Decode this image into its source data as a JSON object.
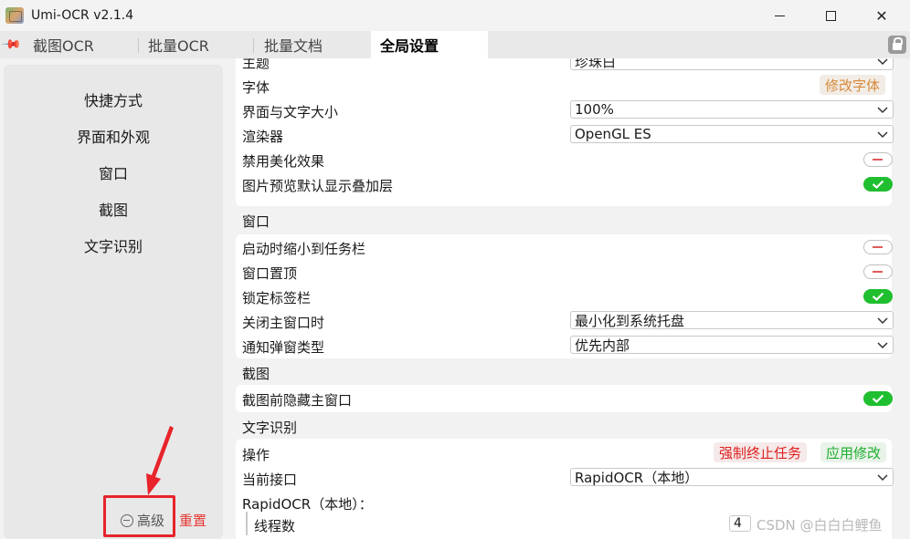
{
  "window": {
    "title": "Umi-OCR v2.1.4",
    "min_icon": "minimize-icon",
    "max_icon": "maximize-icon",
    "close_icon": "close-icon",
    "close_glyph": "✕"
  },
  "tabs": [
    {
      "label": "截图OCR",
      "active": false
    },
    {
      "label": "批量OCR",
      "active": false
    },
    {
      "label": "批量文档",
      "active": false
    },
    {
      "label": "全局设置",
      "active": true
    }
  ],
  "sidebar": {
    "items": [
      "快捷方式",
      "界面和外观",
      "窗口",
      "截图",
      "文字识别"
    ],
    "advanced_label": "高级",
    "reset_label": "重置"
  },
  "settings": {
    "theme_label": "主题",
    "theme_value": "珍珠白",
    "font_label": "字体",
    "font_button": "修改字体",
    "ui_scale_label": "界面与文字大小",
    "ui_scale_value": "100%",
    "renderer_label": "渲染器",
    "renderer_value": "OpenGL ES",
    "disable_effects_label": "禁用美化效果",
    "disable_effects_on": false,
    "preview_overlay_label": "图片预览默认显示叠加层",
    "preview_overlay_on": true,
    "window_section": "窗口",
    "start_minimized_label": "启动时缩小到任务栏",
    "start_minimized_on": false,
    "always_on_top_label": "窗口置顶",
    "always_on_top_on": false,
    "lock_tabs_label": "锁定标签栏",
    "lock_tabs_on": true,
    "close_main_label": "关闭主窗口时",
    "close_main_value": "最小化到系统托盘",
    "notify_type_label": "通知弹窗类型",
    "notify_type_value": "优先内部",
    "screenshot_section": "截图",
    "hide_before_capture_label": "截图前隐藏主窗口",
    "hide_before_capture_on": true,
    "ocr_section": "文字识别",
    "operation_label": "操作",
    "force_stop_button": "强制终止任务",
    "apply_button": "应用修改",
    "current_api_label": "当前接口",
    "current_api_value": "RapidOCR（本地）",
    "rapid_group_label": "RapidOCR（本地）：",
    "threads_label": "线程数",
    "threads_value": "4"
  },
  "watermark": "CSDN @白白白鲤鱼",
  "colors": {
    "toggle_on": "#1fbf2f",
    "stop_red": "#e02020",
    "apply_green": "#1fae2f",
    "annotation_red": "#e8232a"
  }
}
